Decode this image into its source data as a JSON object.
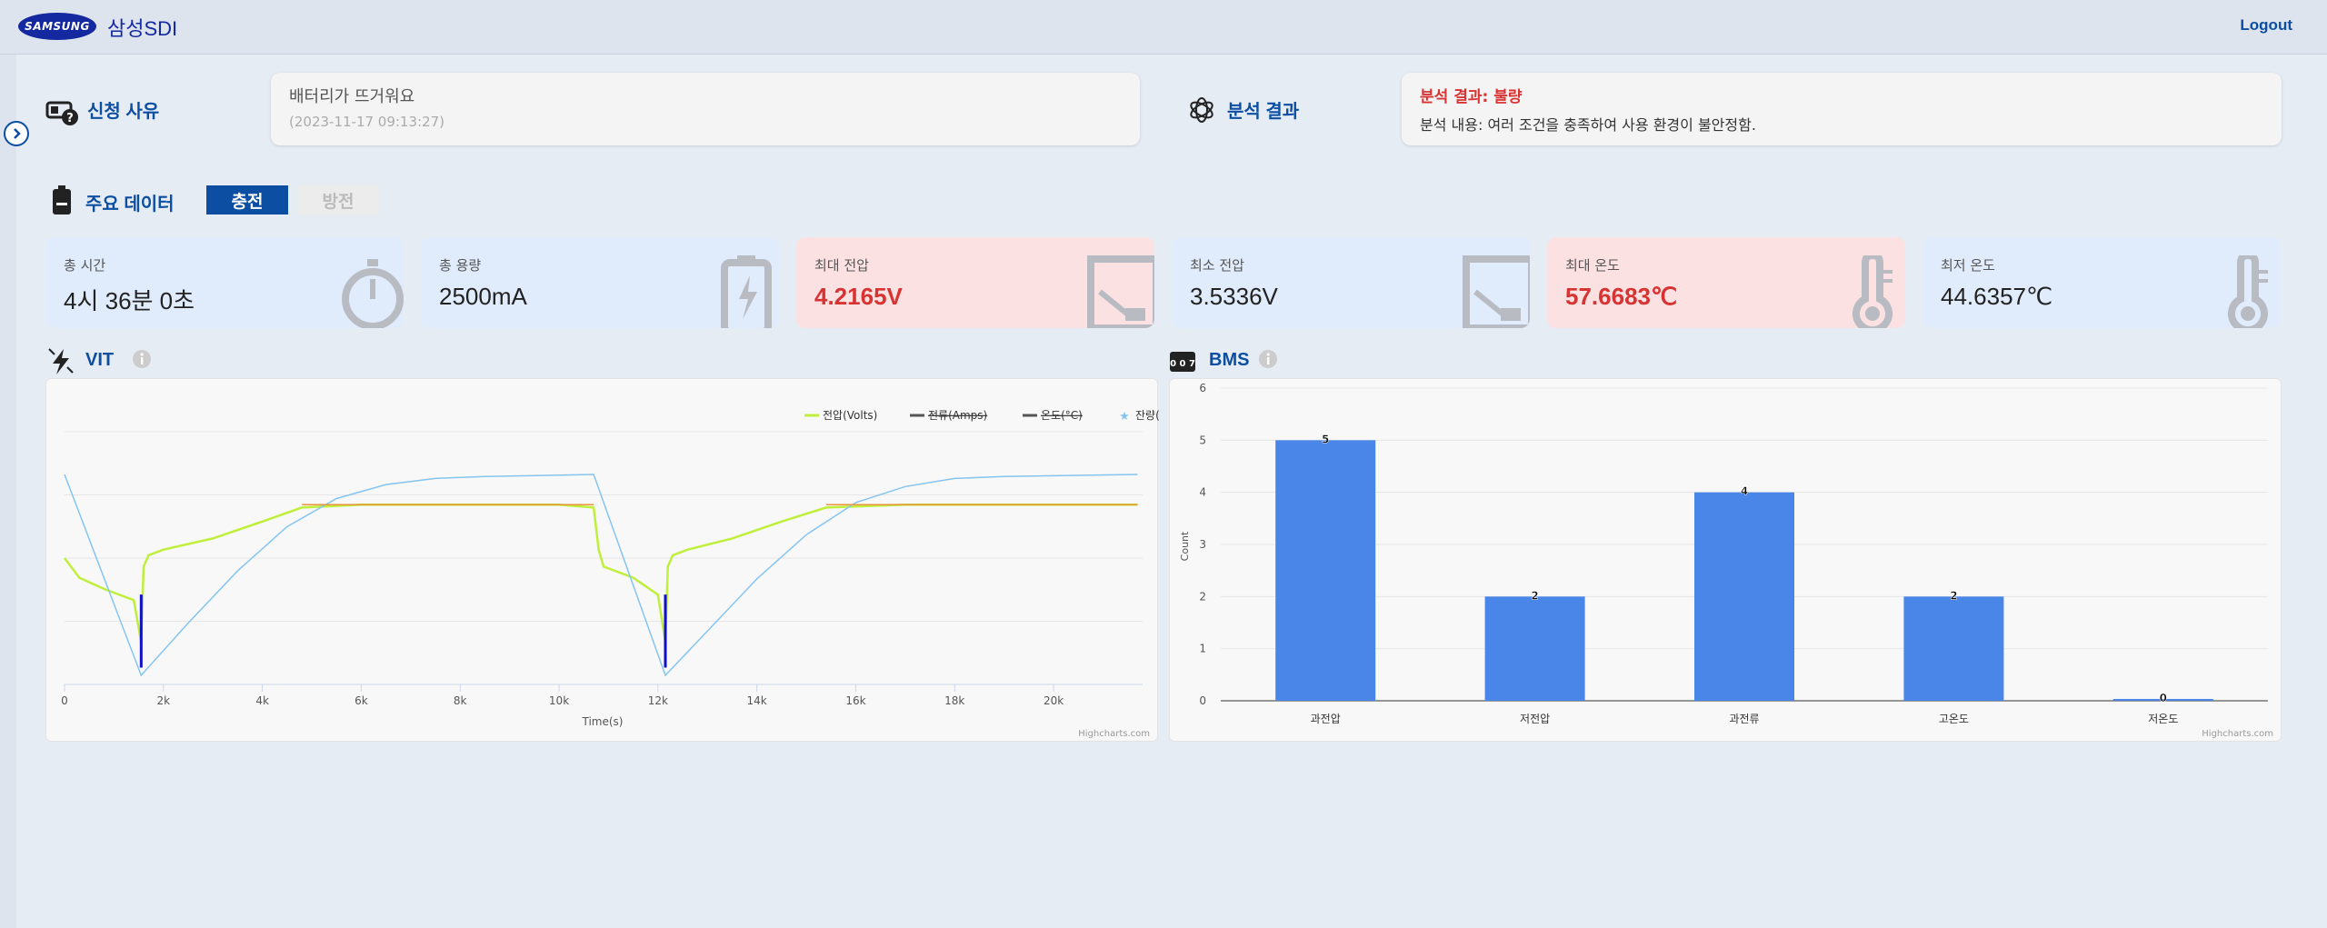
{
  "header": {
    "logo_text": "SAMSUNG",
    "brand": "삼성SDI",
    "logout": "Logout"
  },
  "request": {
    "title": "신청 사유",
    "reason": "배터리가 뜨거워요",
    "date": "(2023-11-17 09:13:27)"
  },
  "analysis": {
    "title": "분석 결과",
    "result": "분석 결과: 불량",
    "content": "분석 내용: 여러 조건을 충족하여 사용 환경이 불안정함."
  },
  "main_data": {
    "title": "주요 데이터",
    "tabs": [
      {
        "label": "충전",
        "active": true
      },
      {
        "label": "방전",
        "active": false
      }
    ]
  },
  "cards": [
    {
      "label": "총 시간",
      "value": "4시 36분 0초",
      "tone": "blue",
      "icon": "stopwatch-icon"
    },
    {
      "label": "총 용량",
      "value": "2500mA",
      "tone": "blue",
      "icon": "battery-charging-icon"
    },
    {
      "label": "최대 전압",
      "value": "4.2165V",
      "tone": "red",
      "icon": "voltmeter-icon"
    },
    {
      "label": "최소 전압",
      "value": "3.5336V",
      "tone": "blue",
      "icon": "voltmeter-icon"
    },
    {
      "label": "최대 온도",
      "value": "57.6683℃",
      "tone": "red",
      "icon": "thermometer-icon"
    },
    {
      "label": "최저 온도",
      "value": "44.6357℃",
      "tone": "blue",
      "icon": "thermometer-icon"
    }
  ],
  "vit": {
    "title": "VIT",
    "credits": "Highcharts.com"
  },
  "bms": {
    "title": "BMS",
    "credits": "Highcharts.com"
  },
  "colors": {
    "accent": "#0b4ea2",
    "danger": "#d83333",
    "bar": "#4a86e8",
    "voltage": "#bfef3b",
    "remain": "#85c4f0",
    "current_spike": "#1010c8",
    "temp": "#e8943a"
  },
  "chart_data": [
    {
      "type": "line",
      "title": "",
      "xlabel": "Time(s)",
      "ylabel": "",
      "xlim": [
        0,
        21800
      ],
      "xticks": [
        "0",
        "2k",
        "4k",
        "6k",
        "8k",
        "10k",
        "12k",
        "14k",
        "16k",
        "18k",
        "20k"
      ],
      "xtick_values": [
        0,
        2000,
        4000,
        6000,
        8000,
        10000,
        12000,
        14000,
        16000,
        18000,
        20000
      ],
      "legend": "top-right",
      "series": [
        {
          "name": "전압(Volts)",
          "visible": true,
          "x": [
            0,
            300,
            800,
            1400,
            1550,
            1600,
            1700,
            2000,
            3000,
            4000,
            4800,
            6000,
            8000,
            10000,
            10700,
            10800,
            10900,
            11500,
            12000,
            12150,
            12200,
            12300,
            12600,
            13500,
            14500,
            15400,
            17000,
            19000,
            21700
          ],
          "y": [
            3.85,
            3.78,
            3.74,
            3.7,
            3.55,
            3.82,
            3.86,
            3.88,
            3.92,
            3.98,
            4.03,
            4.04,
            4.04,
            4.04,
            4.03,
            3.88,
            3.82,
            3.78,
            3.72,
            3.55,
            3.82,
            3.86,
            3.88,
            3.92,
            3.98,
            4.03,
            4.04,
            4.04,
            4.04
          ]
        },
        {
          "name": "전류(Amps)",
          "visible": false
        },
        {
          "name": "온도(°C)",
          "visible": false
        },
        {
          "name": "잔량(%)",
          "visible": true,
          "x": [
            0,
            1550,
            2500,
            3500,
            4500,
            5500,
            6500,
            7500,
            8500,
            10700,
            12150,
            13000,
            14000,
            15000,
            16000,
            17000,
            18000,
            19000,
            21700
          ],
          "y": [
            100,
            0,
            26,
            52,
            74,
            88,
            95,
            98,
            99,
            100,
            0,
            22,
            48,
            70,
            86,
            94,
            98,
            99,
            100
          ]
        }
      ]
    },
    {
      "type": "bar",
      "title": "",
      "xlabel": "",
      "ylabel": "Count",
      "ylim": [
        0,
        6
      ],
      "yticks": [
        "0",
        "1",
        "2",
        "3",
        "4",
        "5",
        "6"
      ],
      "categories": [
        "과전압",
        "저전압",
        "과전류",
        "고온도",
        "저온도"
      ],
      "values": [
        5,
        2,
        4,
        2,
        0
      ],
      "data_labels": [
        "5",
        "2",
        "4",
        "2",
        "0"
      ],
      "grid": true
    }
  ]
}
